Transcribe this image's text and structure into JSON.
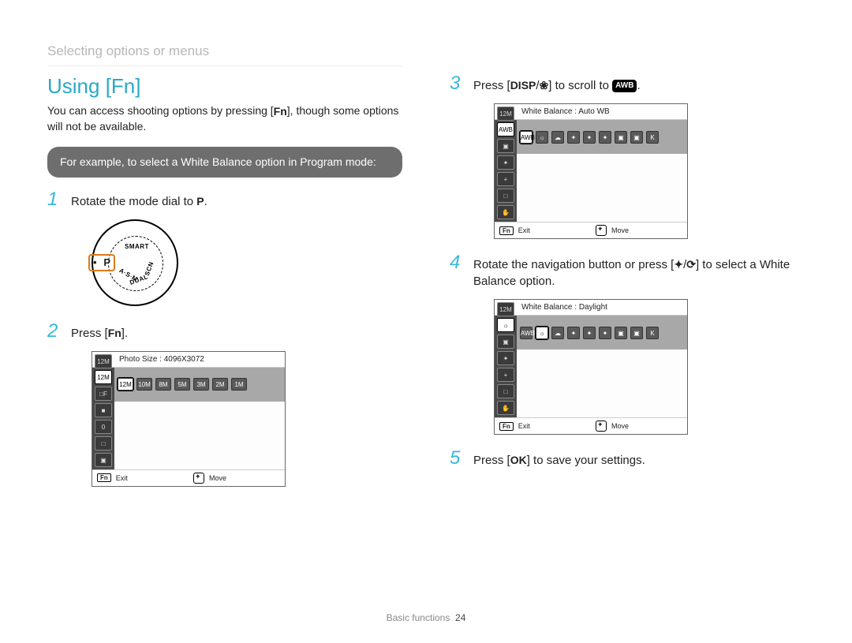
{
  "breadcrumb": "Selecting options or menus",
  "section_title": "Using [Fn]",
  "intro_a": "You can access shooting options by pressing [",
  "intro_fn": "Fn",
  "intro_b": "], though some options will not be available.",
  "example_pill": "For example, to select a White Balance option in Program mode:",
  "step1": {
    "num": "1",
    "text_a": "Rotate the mode dial to ",
    "glyph": "P",
    "text_b": "."
  },
  "dial": {
    "smart": "SMART",
    "asm": "A·S·M",
    "dual": "DUAL",
    "scn": "SCN",
    "p": "P"
  },
  "step2": {
    "num": "2",
    "text_a": "Press [",
    "glyph": "Fn",
    "text_b": "]."
  },
  "lcd1": {
    "title": "Photo Size : 4096X3072",
    "side_top": "12M",
    "side": [
      "12M",
      "□F",
      "■",
      "0",
      "□",
      "▣"
    ],
    "options": [
      "12M",
      "10M",
      "8M",
      "5M",
      "3M",
      "2M",
      "1M"
    ],
    "footer": {
      "fn": "Fn",
      "exit": "Exit",
      "move": "Move"
    }
  },
  "step3": {
    "num": "3",
    "text_a": "Press [",
    "glyph1": "DISP",
    "slash": "/",
    "glyph2": "❀",
    "text_b": "] to scroll to ",
    "awb": "AWB",
    "text_c": "."
  },
  "lcd2": {
    "title": "White Balance : Auto WB",
    "side_top": "12M",
    "side": [
      "AWB",
      "▣",
      "✦",
      "+",
      "□",
      "✋"
    ],
    "options": [
      "AWB",
      "☼",
      "☁",
      "✦",
      "✦",
      "✦",
      "▣",
      "▣",
      "K"
    ],
    "footer": {
      "fn": "Fn",
      "exit": "Exit",
      "move": "Move"
    }
  },
  "step4": {
    "num": "4",
    "text_a": "Rotate the navigation button or press [",
    "glyph1": "✦",
    "slash": "/",
    "glyph2": "⟳",
    "text_b": "] to select a White Balance option."
  },
  "lcd3": {
    "title": "White Balance : Daylight",
    "side_top": "12M",
    "side": [
      "☼",
      "▣",
      "✦",
      "+",
      "□",
      "✋"
    ],
    "options": [
      "AWB",
      "☼",
      "☁",
      "✦",
      "✦",
      "✦",
      "▣",
      "▣",
      "K"
    ],
    "sel_index": 1,
    "footer": {
      "fn": "Fn",
      "exit": "Exit",
      "move": "Move"
    }
  },
  "step5": {
    "num": "5",
    "text_a": "Press [",
    "glyph": "OK",
    "text_b": "] to save your settings."
  },
  "footer": {
    "section": "Basic functions",
    "page": "24"
  }
}
